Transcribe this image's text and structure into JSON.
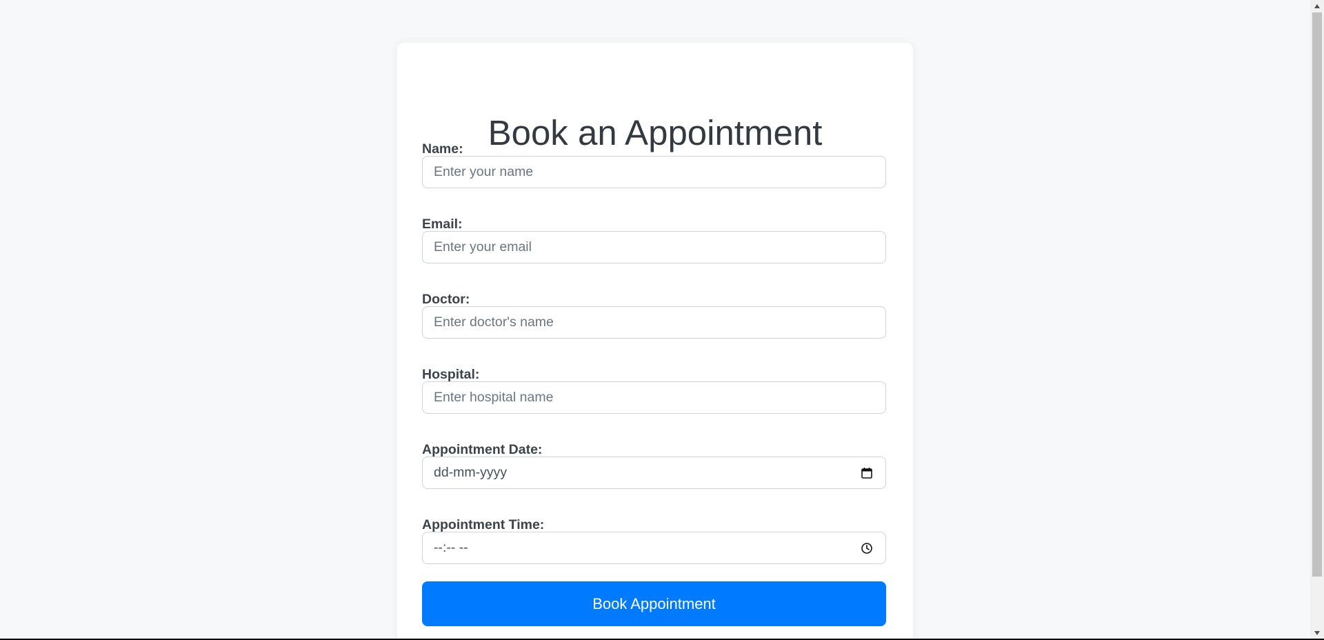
{
  "page": {
    "title": "Book an Appointment"
  },
  "form": {
    "fields": [
      {
        "label": "Name:",
        "placeholder": "Enter your name",
        "value": "",
        "type": "text"
      },
      {
        "label": "Email:",
        "placeholder": "Enter your email",
        "value": "",
        "type": "email"
      },
      {
        "label": "Doctor:",
        "placeholder": "Enter doctor's name",
        "value": "",
        "type": "text"
      },
      {
        "label": "Hospital:",
        "placeholder": "Enter hospital name",
        "value": "",
        "type": "text"
      },
      {
        "label": "Appointment Date:",
        "placeholder": "dd-mm-yyyy",
        "value": "",
        "type": "date",
        "icon": "calendar-icon"
      },
      {
        "label": "Appointment Time:",
        "placeholder": "--:-- --",
        "value": "",
        "type": "time",
        "icon": "clock-icon"
      }
    ],
    "submit_label": "Book Appointment"
  },
  "colors": {
    "page_background": "#f7f8fa",
    "card_background": "#ffffff",
    "title": "#343a40",
    "label": "#3d4349",
    "placeholder": "#6c757d",
    "input_border": "#ced4da",
    "primary_button": "#007bff",
    "primary_button_text": "#ffffff"
  },
  "scrollbar": {
    "up_arrow_icon": "scroll-up-arrow-icon",
    "down_arrow_icon": "scroll-down-arrow-icon"
  }
}
